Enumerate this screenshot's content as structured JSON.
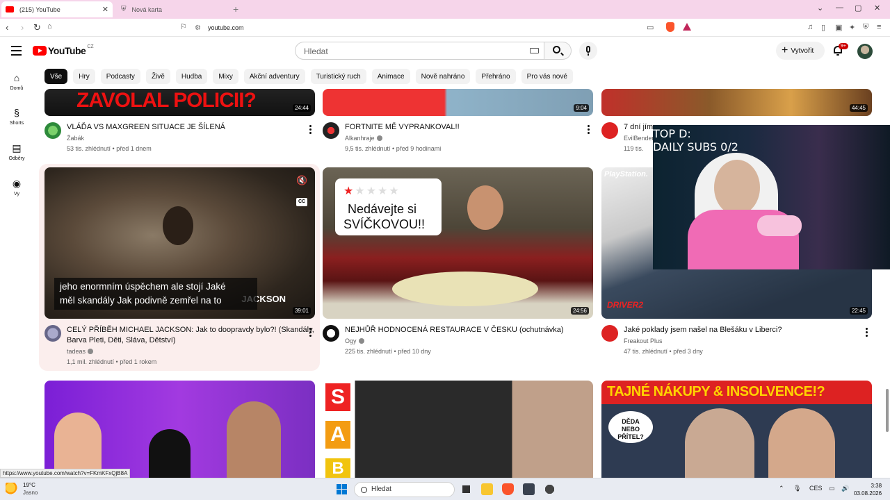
{
  "browser": {
    "tabs": [
      {
        "label": "(215) YouTube",
        "active": true
      },
      {
        "label": "Nová karta",
        "active": false
      }
    ],
    "url": "youtube.com",
    "status_url": "https://www.youtube.com/watch?v=FKmKFxQjB8A"
  },
  "header": {
    "logo_text": "YouTube",
    "logo_region": "CZ",
    "search_placeholder": "Hledat",
    "create_label": "Vytvořit",
    "notification_count": "9+"
  },
  "chips": [
    "Vše",
    "Hry",
    "Podcasty",
    "Živě",
    "Hudba",
    "Mixy",
    "Akční adventury",
    "Turistický ruch",
    "Animace",
    "Nově nahráno",
    "Přehráno",
    "Pro vás nové"
  ],
  "leftnav": [
    {
      "label": "Domů",
      "icon": "home-icon"
    },
    {
      "label": "Shorts",
      "icon": "shorts-icon"
    },
    {
      "label": "Odběry",
      "icon": "subscriptions-icon"
    },
    {
      "label": "Vy",
      "icon": "you-icon"
    }
  ],
  "row1": [
    {
      "title": "VLÁĎA VS MAXGREEN SITUACE JE ŠÍLENÁ",
      "channel": "Žabák",
      "meta": "53 tis. zhlédnutí • před 1 dnem",
      "duration": "24:44",
      "thumb_text": "ZAVOLAL POLICII?"
    },
    {
      "title": "FORTNITE MĚ VYPRANKOVAL!!",
      "channel": "Alkanhraje",
      "meta": "9,5 tis. zhlédnutí • před 9 hodinami",
      "duration": "9:04"
    },
    {
      "title": "7 dní jím",
      "channel": "EvilBender",
      "meta": "119 tis.",
      "duration": "44:45"
    }
  ],
  "row2": [
    {
      "title_line1": "CELÝ PŘÍBĚH MICHAEL JACKSON: Jak to doopravdy bylo?! (Skandály,",
      "title_line2": "Barva Pleti, Děti, Sláva, Dětství)",
      "channel": "tadeas",
      "meta": "1,1 mil. zhlédnutí • před 1 rokem",
      "duration": "39:01",
      "subtitle_line1": "jeho enormním úspěchem ale stojí Jaké",
      "subtitle_line2": "měl skandály Jak podivně zemřel na to",
      "thumb_text": "JACKSON"
    },
    {
      "title": "NEJHŮŘ HODNOCENÁ RESTAURACE V ČESKU (ochutnávka)",
      "channel": "Ogy",
      "meta": "225 tis. zhlédnutí • před 10 dny",
      "duration": "24:56",
      "thumb_text_line1": "Nedávejte si",
      "thumb_text_line2": "SVÍČKOVOU!!"
    },
    {
      "title": "Jaké poklady jsem našel na Blešáku v Liberci?",
      "channel": "Freakout Plus",
      "meta": "47 tis. zhlédnutí • před 3 dny",
      "duration": "22:45",
      "thumb_text_brand": "PlayStation.",
      "thumb_text_game": "DRIVER2"
    }
  ],
  "row3": [
    {
      "thumb_text": ""
    },
    {
      "thumb_text": "S A R"
    },
    {
      "thumb_text": "TAJNÉ NÁKUPY & INSOLVENCE!?",
      "bubble": "DĚDA NEBO PŘÍTEL?"
    }
  ],
  "overlay": {
    "line1": "TOP D:",
    "line2": "DAILY SUBS 0/2"
  },
  "taskbar": {
    "temperature": "19°C",
    "weather": "Jasno",
    "search_label": "Hledat",
    "language": "CES",
    "time": "3:38",
    "date": "03.08.2026"
  },
  "colors": {
    "accent": "#ff0000",
    "tabstrip": "#f6d5ea",
    "hover_card": "#fbeeed"
  }
}
